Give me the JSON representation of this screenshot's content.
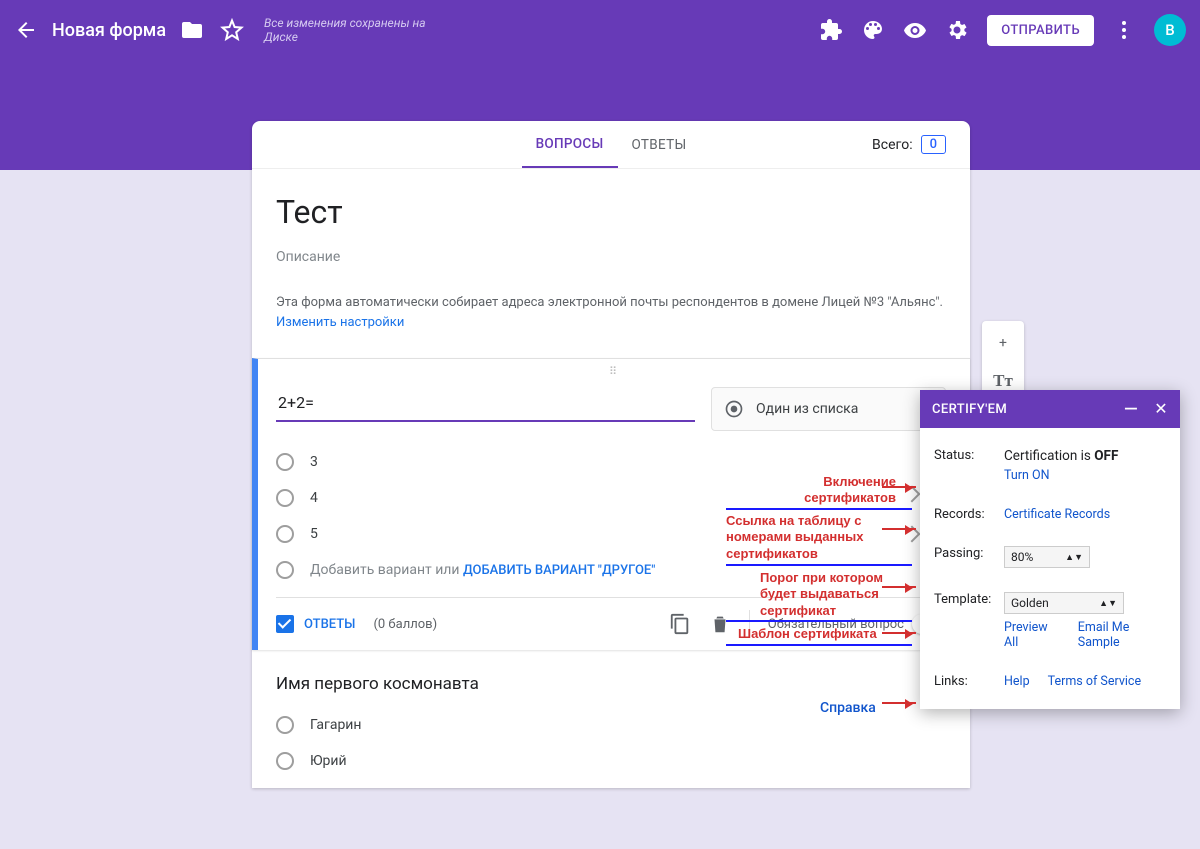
{
  "header": {
    "title": "Новая форма",
    "save_status": "Все изменения сохранены на Диске",
    "send_label": "ОТПРАВИТЬ",
    "avatar_letter": "В"
  },
  "tabs": {
    "questions": "ВОПРОСЫ",
    "answers": "ОТВЕТЫ",
    "total_label": "Всего:",
    "total_count": "0"
  },
  "form": {
    "title": "Тест",
    "description": "Описание",
    "notice_text": "Эта форма автоматически собирает адреса электронной почты респондентов в домене Лицей №3 \"Альянс\". ",
    "notice_link": "Изменить настройки"
  },
  "q1": {
    "text": "2+2=",
    "type_label": "Один из списка",
    "options": [
      "3",
      "4",
      "5"
    ],
    "add_option": "Добавить вариант",
    "or": " или ",
    "add_other": "ДОБАВИТЬ ВАРИАНТ \"ДРУГОЕ\"",
    "answers_label": "ОТВЕТЫ",
    "points": "(0 баллов)",
    "required_label": "Обязательный вопрос"
  },
  "q2": {
    "text": "Имя первого космонавта",
    "options": [
      "Гагарин",
      "Юрий"
    ]
  },
  "help": "Справка",
  "panel": {
    "title": "CERTIFY'EM",
    "status_label": "Status:",
    "status_value": "Certification is ",
    "status_off": "OFF",
    "turn_on": "Turn ON",
    "records_label": "Records:",
    "records_link": "Certificate Records",
    "passing_label": "Passing:",
    "passing_value": "80%",
    "template_label": "Template:",
    "template_value": "Golden",
    "preview": "Preview All",
    "email_sample": "Email Me Sample",
    "links_label": "Links:",
    "help": "Help",
    "tos": "Terms of Service"
  },
  "annotations": {
    "a1": "Включение сертификатов",
    "a2": "Ссылка на таблицу с номерами выданных сертификатов",
    "a3": "Порог при котором будет выдаваться сертификат",
    "a4": "Шаблон сертификата"
  }
}
